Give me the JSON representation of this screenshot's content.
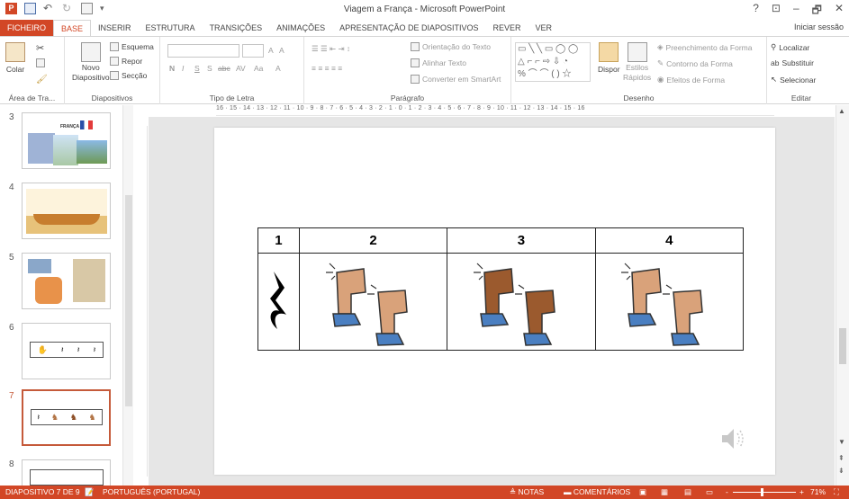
{
  "window": {
    "title": "Viagem a França - Microsoft PowerPoint",
    "help": "?",
    "ribbon_display": "⊡",
    "minimize": "–",
    "restore": "🗗",
    "close": "✕"
  },
  "tabs": [
    {
      "label": "FICHEIRO"
    },
    {
      "label": "BASE"
    },
    {
      "label": "INSERIR"
    },
    {
      "label": "ESTRUTURA"
    },
    {
      "label": "TRANSIÇÕES"
    },
    {
      "label": "ANIMAÇÕES"
    },
    {
      "label": "APRESENTAÇÃO DE DIAPOSITIVOS"
    },
    {
      "label": "REVER"
    },
    {
      "label": "VER"
    }
  ],
  "sign_in": "Iniciar sessão",
  "ribbon": {
    "clipboard": {
      "paste": "Colar",
      "label": "Área de Tra..."
    },
    "slides": {
      "new_slide": "Novo",
      "new_slide2": "Diapositivo",
      "layout": "Esquema",
      "reset": "Repor",
      "section": "Secção",
      "label": "Diapositivos"
    },
    "font": {
      "bold": "N",
      "italic": "I",
      "underline": "S",
      "shadow": "S",
      "strike": "abc",
      "spacing": "AV",
      "case": "Aa",
      "color": "A",
      "grow": "A",
      "shrink": "A",
      "label": "Tipo de Letra"
    },
    "paragraph": {
      "text_direction": "Orientação do Texto",
      "align_text": "Alinhar Texto",
      "smartart": "Converter em SmartArt",
      "label": "Parágrafo"
    },
    "drawing": {
      "arrange": "Dispor",
      "quick_styles": "Estilos",
      "quick_styles2": "Rápidos",
      "fill": "Preenchimento da Forma",
      "outline": "Contorno da Forma",
      "effects": "Efeitos de Forma",
      "label": "Desenho"
    },
    "editing": {
      "find": "Localizar",
      "replace": "Substituir",
      "select": "Selecionar",
      "label": "Editar"
    }
  },
  "ruler_text": "16 · 15 · 14 · 13 · 12 · 11 · 10 · 9 · 8 · 7 · 6 · 5 · 4 · 3 · 2 · 1 · 0 · 1 · 2 · 3 · 4 · 5 · 6 · 7 · 8 · 9 · 10 · 11 · 12 · 13 · 14 · 15 · 16",
  "thumbnails": [
    {
      "num": "3",
      "caption": "FRANÇA"
    },
    {
      "num": "4"
    },
    {
      "num": "5"
    },
    {
      "num": "6"
    },
    {
      "num": "7"
    },
    {
      "num": "8"
    }
  ],
  "slide_table": {
    "headers": [
      "1",
      "2",
      "3",
      "4"
    ]
  },
  "status": {
    "slide_info": "DIAPOSITIVO 7 DE 9",
    "language": "PORTUGUÊS (PORTUGAL)",
    "notes": "NOTAS",
    "comments": "COMENTÁRIOS",
    "zoom": "71%",
    "zoom_out": "-",
    "zoom_in": "+"
  },
  "colors": {
    "accent": "#d24726",
    "leg_light": "#d9a27a",
    "leg_dark": "#9b5a2e",
    "shoe": "#4a7fc1"
  }
}
